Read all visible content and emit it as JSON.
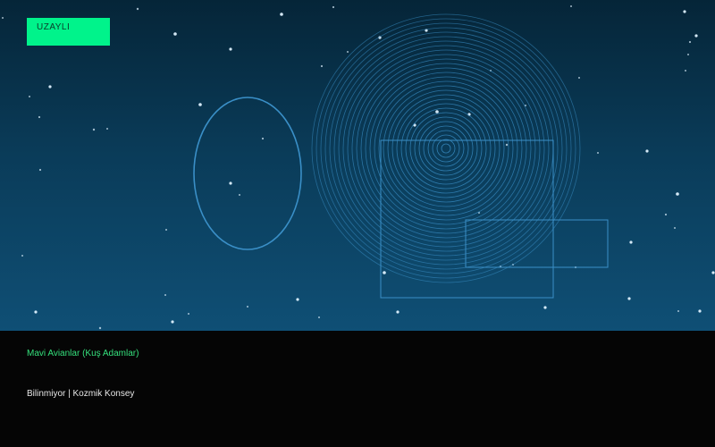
{
  "badge": {
    "label": "UZAYLI",
    "color": "#00f38b"
  },
  "details": {
    "title": "Mavi Avianlar (Kuş Adamlar)",
    "meta": "Bilinmiyor | Kozmik Konsey"
  },
  "colors": {
    "accent": "#35e07c",
    "line": "#3a8fc7",
    "panel": "#050505"
  }
}
